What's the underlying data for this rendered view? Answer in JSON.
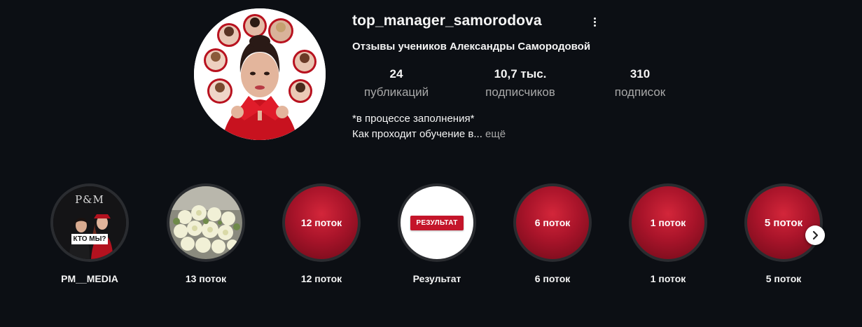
{
  "profile": {
    "username": "top_manager_samorodova",
    "full_name": "Отзывы учеников Александры Самородовой",
    "more_icon": "more-vertical-icon",
    "avatar_icon": "profile-photo"
  },
  "stats": {
    "posts": {
      "value": "24",
      "label": "публикаций"
    },
    "followers": {
      "value": "10,7 тыс.",
      "label": "подписчиков"
    },
    "following": {
      "value": "310",
      "label": "подписок"
    }
  },
  "bio": {
    "line1": "*в процессе заполнения*",
    "line2": "Как проходит обучение в...",
    "more_label": "ещё"
  },
  "highlights": [
    {
      "title": "PM__MEDIA",
      "cover_kind": "photo",
      "cover_logo": "P&M",
      "cover_caption": "КТО МЫ?"
    },
    {
      "title": "13 поток",
      "cover_kind": "photo"
    },
    {
      "title": "12 поток",
      "cover_kind": "red",
      "cover_text": "12 поток"
    },
    {
      "title": "Результат",
      "cover_kind": "white",
      "cover_text": "РЕЗУЛЬТАТ"
    },
    {
      "title": "6 поток",
      "cover_kind": "red",
      "cover_text": "6 поток"
    },
    {
      "title": "1 поток",
      "cover_kind": "red",
      "cover_text": "1 поток"
    },
    {
      "title": "5 поток",
      "cover_kind": "red",
      "cover_text": "5 поток"
    }
  ],
  "navigation": {
    "next_icon": "chevron-right-icon"
  },
  "colors": {
    "background": "#0c0f14",
    "text": "#f5f5f5",
    "muted": "#a8a8a8",
    "highlight_red": "#a9142a",
    "highlight_ring": "#2a2c30"
  }
}
